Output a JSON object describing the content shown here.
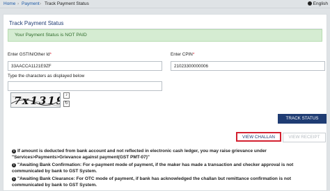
{
  "breadcrumb": {
    "home": "Home",
    "payment": "Payment",
    "current": "Track Payment Status",
    "separator": "›"
  },
  "header": {
    "language": "English"
  },
  "page": {
    "title": "Track Payment Status",
    "alert": "Your Payment Status is NOT PAID"
  },
  "form": {
    "gstin_label": "Enter GSTIN/Other Id",
    "gstin_value": "33AACCA1121E9ZF",
    "cpin_label": "Enter CPIN",
    "cpin_value": "21023300000006",
    "captcha_label": "Type the characters as displayed below",
    "captcha_value": "",
    "captcha_text": "7x1319",
    "required_mark": "*"
  },
  "buttons": {
    "track_status": "TRACK STATUS",
    "view_challan": "VIEW CHALLAN",
    "view_receipt": "VIEW RECEIPT"
  },
  "notes": [
    "If amount is deducted from bank account and not reflected in electronic cash ledger, you may raise grievance under \"Services>Payments>Grievance against payment(GST PMT-07)\"",
    "\"Awaiting Bank Confirmation: For e-payment mode of payment, if the maker has made a transaction and checker approval is not communicated by bank to GST System.",
    "\"Awaiting Bank Clearance: For OTC mode of payment, if bank has acknowledged the challan but remittance confirmation is not communicated by bank to GST System."
  ],
  "colors": {
    "brand_navy": "#1f3c73",
    "alert_bg": "#d5ecd2",
    "alert_text": "#2e6b2a",
    "highlight_red": "#d3202f"
  }
}
